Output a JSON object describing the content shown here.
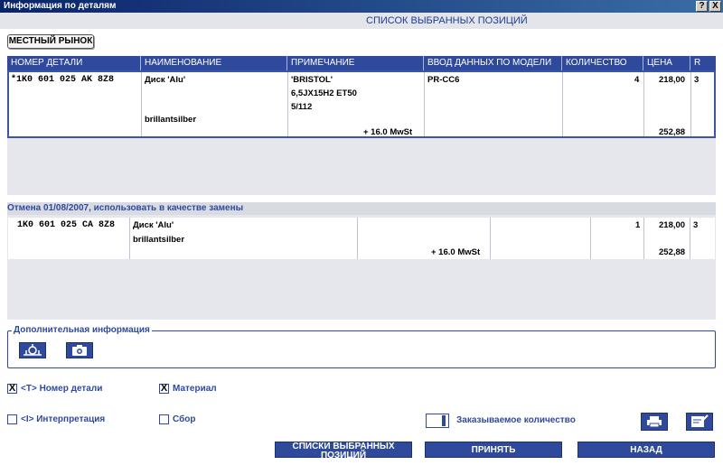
{
  "window": {
    "title": "Информация по деталям",
    "help_label": "?",
    "close_label": "X"
  },
  "subtitle": "СПИСОК ВЫБРАННЫХ ПОЗИЦИЙ",
  "market_button": "МЕСТНЫЙ РЫНОК",
  "columns": [
    "НОМЕР ДЕТАЛИ",
    "НАИМЕНОВАНИЕ",
    "ПРИМЕЧАНИЕ",
    "ВВОД ДАННЫХ ПО МОДЕЛИ",
    "КОЛИЧЕСТВО",
    "ЦЕНА",
    "R"
  ],
  "row1": {
    "part_number": "*1K0 601 025 AK 8Z8",
    "name": "Диск 'Alu'",
    "name2": "brillantsilber",
    "note_lines": [
      "'BRISTOL'",
      "6,5JX15H2 ET50",
      "5/112"
    ],
    "tax": "+  16.0 MwSt",
    "model": "PR-CC6",
    "quantity": "4",
    "price": "218,00",
    "price_total": "252,88",
    "r": "3"
  },
  "cancel_note": "Отмена 01/08/2007, использовать в качестве замены",
  "row2": {
    "part_number": "1K0 601 025 CA 8Z8",
    "name": "Диск 'Alu'",
    "name2": "brillantsilber",
    "tax": "+  16.0 MwSt",
    "quantity": "1",
    "price": "218,00",
    "price_total": "252,88",
    "r": "3"
  },
  "extra_info": {
    "legend": "Дополнительная информация",
    "icons": [
      "diagram-icon",
      "camera-icon"
    ]
  },
  "checkboxes": {
    "part_number": {
      "label": "<T> Номер детали",
      "checked": "X"
    },
    "material": {
      "label": "Материал",
      "checked": "X"
    },
    "interpretation": {
      "label": "<I> Интерпретация",
      "checked": ""
    },
    "assembly": {
      "label": "Сбор",
      "checked": ""
    }
  },
  "order_qty_label": "Заказываемое количество",
  "buttons": {
    "lists": "СПИСКИ ВЫБРАННЫХ ПОЗИЦИЙ",
    "accept": "ПРИНЯТЬ",
    "back": "НАЗАД"
  },
  "colors": {
    "accent": "#2f4a9c",
    "panel": "#e6e7ec"
  }
}
